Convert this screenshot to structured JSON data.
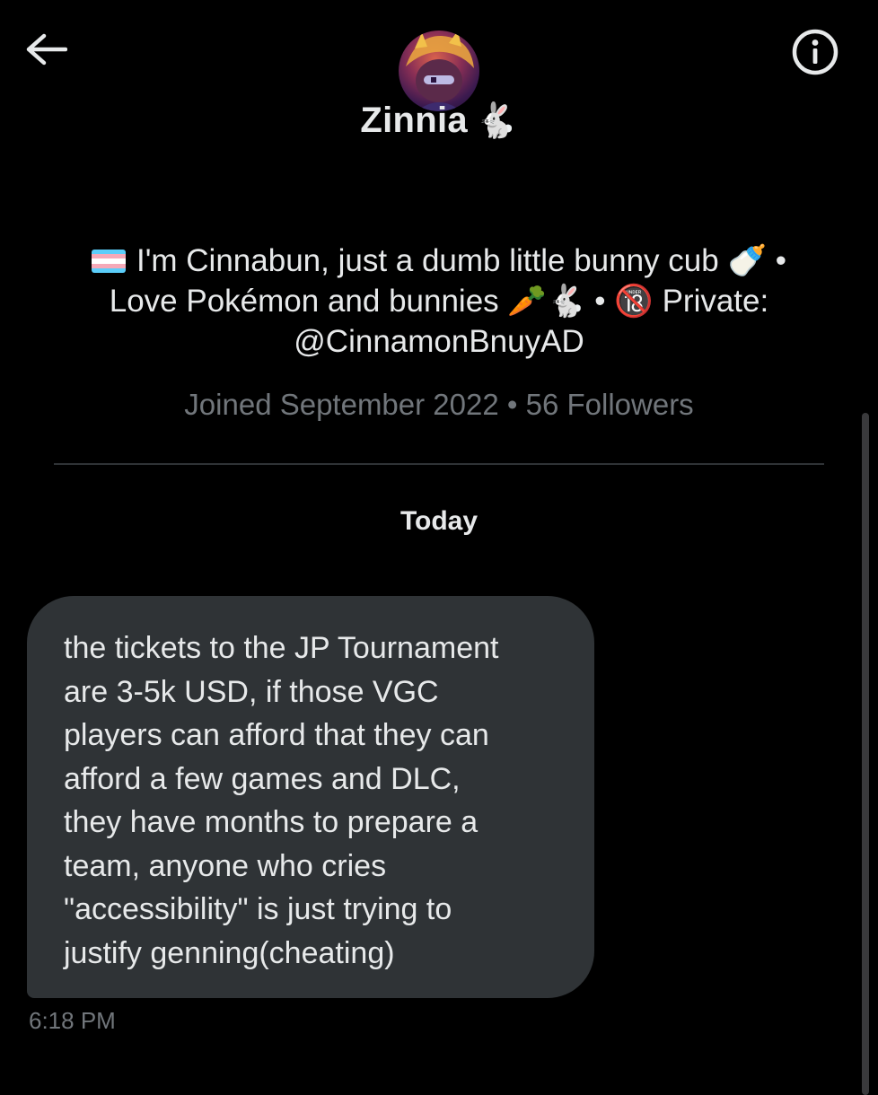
{
  "header": {
    "back_icon": "arrow-left-icon",
    "info_icon": "info-circle-icon",
    "display_name": "Zinnia",
    "name_emoji": "🐇"
  },
  "profile": {
    "flag_icon": "transgender-flag-icon",
    "bio_line1": "I'm Cinnabun, just a dumb little bunny cub 🍼 •",
    "bio_line2": "Love Pokémon and bunnies 🥕🐇 • 🔞 Private:",
    "bio_line3": "@CinnamonBnuyAD",
    "meta": "Joined September 2022 • 56 Followers"
  },
  "conversation": {
    "date_label": "Today",
    "message": {
      "text": "the tickets to the JP Tournament\nare 3-5k USD, if those VGC\nplayers can afford that they can\nafford a few games and DLC,\nthey have months to prepare a\nteam, anyone who cries\n\"accessibility\" is just trying to\njustify genning(cheating)",
      "time": "6:18 PM"
    }
  },
  "colors": {
    "background": "#000000",
    "primary_text": "#e7e9ea",
    "secondary_text": "#71767b",
    "bubble": "#2f3336",
    "divider": "#2f3336"
  }
}
